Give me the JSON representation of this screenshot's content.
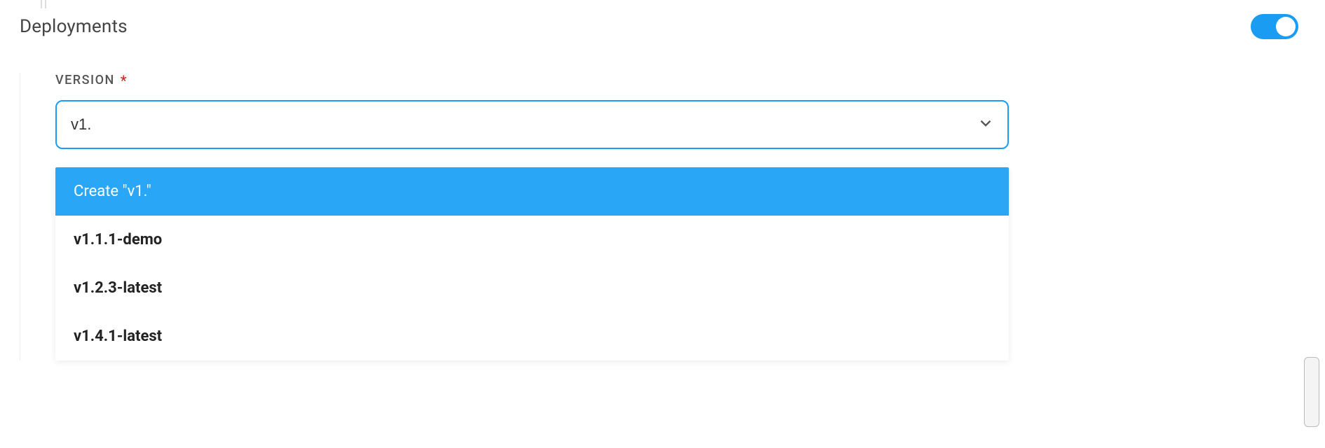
{
  "section": {
    "title": "Deployments"
  },
  "toggle": {
    "state": "on"
  },
  "field": {
    "label": "VERSION",
    "required_marker": "*",
    "value": "v1."
  },
  "dropdown": {
    "create_label": "Create \"v1.\"",
    "options": [
      "v1.1.1-demo",
      "v1.2.3-latest",
      "v1.4.1-latest"
    ]
  }
}
